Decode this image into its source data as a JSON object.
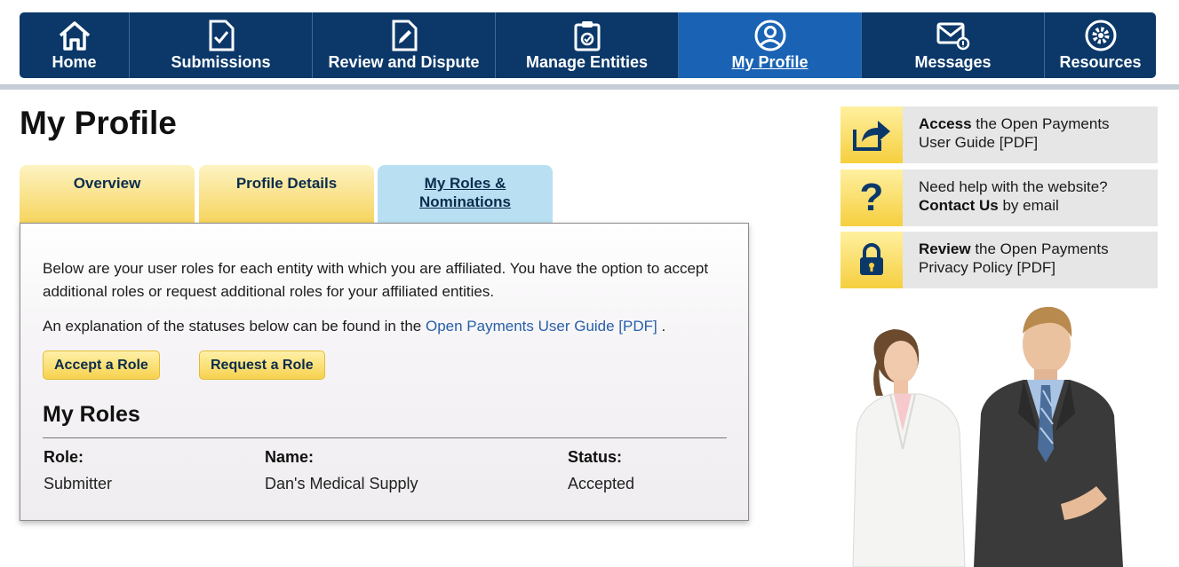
{
  "nav": {
    "items": [
      {
        "label": "Home",
        "icon": "home-icon"
      },
      {
        "label": "Submissions",
        "icon": "document-check-icon"
      },
      {
        "label": "Review and Dispute",
        "icon": "document-edit-icon"
      },
      {
        "label": "Manage Entities",
        "icon": "clipboard-icon"
      },
      {
        "label": "My Profile",
        "icon": "user-icon",
        "active": true
      },
      {
        "label": "Messages",
        "icon": "mail-icon"
      },
      {
        "label": "Resources",
        "icon": "gear-icon"
      }
    ]
  },
  "page": {
    "title": "My Profile"
  },
  "tabs": [
    {
      "label": "Overview"
    },
    {
      "label": "Profile Details"
    },
    {
      "label_line1": "My Roles &",
      "label_line2": "Nominations",
      "active": true
    }
  ],
  "panel": {
    "intro": "Below are your user roles for each entity with which you are affiliated. You have the option to accept additional roles or request additional roles for your affiliated entities.",
    "explanation_prefix": "An explanation of the statuses below can be found in the",
    "guide_link": "Open Payments User Guide [PDF]",
    "explanation_suffix": ".",
    "accept_button": "Accept a Role",
    "request_button": "Request a Role",
    "roles_title": "My Roles",
    "table": {
      "headers": [
        "Role:",
        "Name:",
        "Status:"
      ],
      "rows": [
        [
          "Submitter",
          "Dan's Medical Supply",
          "Accepted"
        ]
      ]
    }
  },
  "sidebar": {
    "links": [
      {
        "icon": "share-icon",
        "bold": "Access",
        "text": " the Open Payments",
        "line2": "User Guide [PDF]"
      },
      {
        "icon": "question-icon",
        "line1": "Need help with the website?",
        "bold": "Contact Us",
        "text": " by email"
      },
      {
        "icon": "lock-icon",
        "bold": "Review",
        "text": " the Open Payments",
        "line2": "Privacy Policy [PDF]"
      }
    ]
  },
  "colors": {
    "nav": "#0b3869",
    "nav_active": "#1a63b4",
    "tab_yellow": "#f6d45c",
    "tab_blue": "#b9dff2",
    "link": "#2860a8"
  }
}
